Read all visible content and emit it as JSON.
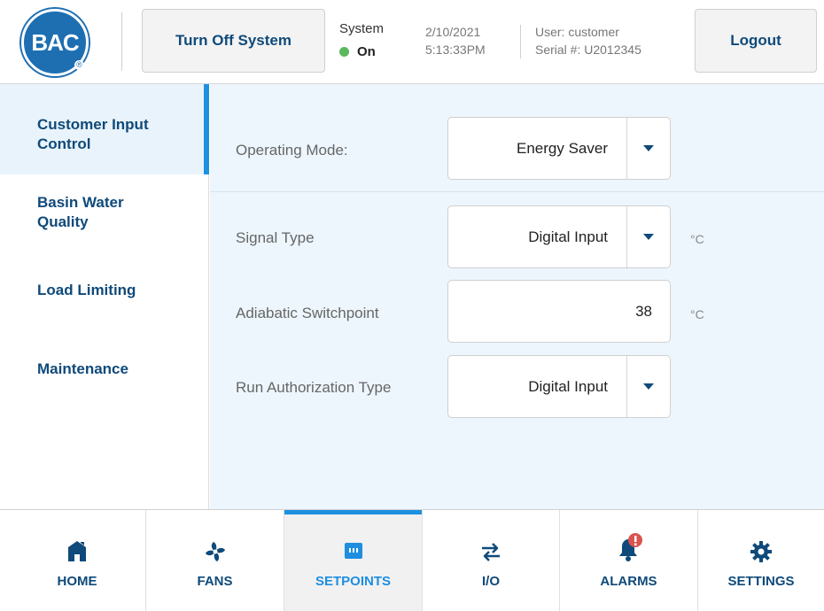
{
  "header": {
    "logo_text": "BAC",
    "turn_off_label": "Turn Off System",
    "system_label": "System",
    "system_state": "On",
    "status_color": "#5bb95b",
    "date": "2/10/2021",
    "time": "5:13:33PM",
    "user": "User: customer",
    "serial": "Serial #: U2012345",
    "logout_label": "Logout"
  },
  "sidebar": {
    "items": [
      {
        "label": "Customer Input Control",
        "active": true
      },
      {
        "label": "Basin Water Quality",
        "active": false
      },
      {
        "label": "Load Limiting",
        "active": false
      },
      {
        "label": "Maintenance",
        "active": false
      }
    ]
  },
  "main": {
    "operating_mode": {
      "label": "Operating Mode:",
      "value": "Energy Saver"
    },
    "signal_type": {
      "label": "Signal Type",
      "value": "Digital Input",
      "unit": "°C"
    },
    "adiabatic_switchpoint": {
      "label": "Adiabatic Switchpoint",
      "value": "38",
      "unit": "°C"
    },
    "run_authorization_type": {
      "label": "Run Authorization Type",
      "value": "Digital Input"
    }
  },
  "bottom_nav": {
    "items": [
      {
        "label": "HOME",
        "icon": "home-icon"
      },
      {
        "label": "FANS",
        "icon": "fan-icon"
      },
      {
        "label": "SETPOINTS",
        "icon": "setpoints-icon",
        "active": true
      },
      {
        "label": "I/O",
        "icon": "swap-arrows-icon"
      },
      {
        "label": "ALARMS",
        "icon": "bell-alert-icon"
      },
      {
        "label": "SETTINGS",
        "icon": "gear-icon"
      }
    ]
  },
  "colors": {
    "brand": "#1e6fb2",
    "accent": "#1e90e0",
    "nav_text": "#0f4a7a",
    "alarm": "#d9534f"
  }
}
